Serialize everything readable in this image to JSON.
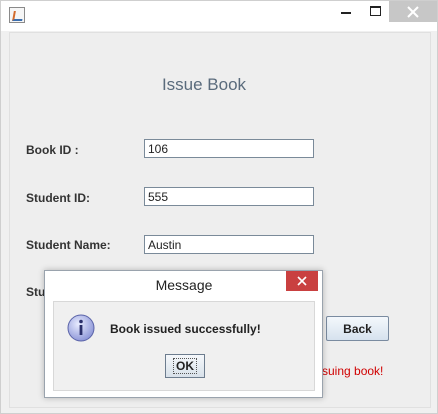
{
  "window": {
    "app_icon": "java-icon"
  },
  "form": {
    "heading": "Issue Book",
    "book_id_label": "Book ID :",
    "book_id_value": "106",
    "student_id_label": "Student ID:",
    "student_id_value": "555",
    "student_name_label": "Student Name:",
    "student_name_value": "Austin",
    "partial_label": "Stu",
    "back_label": "Back",
    "status_text": "suing book!",
    "status_color": "#d00000"
  },
  "dialog": {
    "title": "Message",
    "message": "Book issued successfully!",
    "ok_label": "OK",
    "icon": "info-icon"
  },
  "colors": {
    "close_button": "#c94040",
    "heading": "#5a6b7c"
  }
}
